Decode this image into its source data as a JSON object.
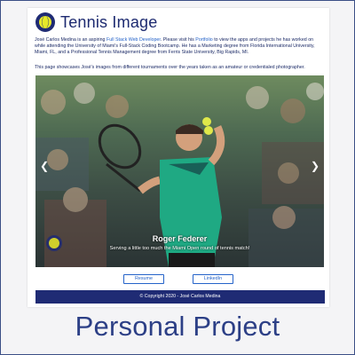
{
  "header": {
    "brand": "Tennis Image",
    "logo_icon": "tennis-ball-icon"
  },
  "bio": {
    "text1": "José Carlos Medina is an aspiring ",
    "link1": "Full Stack Web Developer",
    "text2": ". Please visit his ",
    "link2": "Portfolio",
    "text3": " to view the apps and projects he has worked on while attending the University of Miami's Full-Stack Coding Bootcamp. He has a Marketing degree from Florida International University, Miami, FL, and a Professional Tennis Management degree from Ferris State University, Big Rapids, MI."
  },
  "showcase": "This page showcases José's images from different tournaments over the years taken as an amateur or credentialed photographer.",
  "photo": {
    "caption_name": "Roger Federer",
    "caption_sub": "Serving a little too much the Miami Open round of tennis match!",
    "prev_icon": "chevron-left-icon",
    "next_icon": "chevron-right-icon"
  },
  "buttons": {
    "resume": "Resume",
    "linkedin": "LinkedIn"
  },
  "footer": "© Copyright 2020 - José Carlos Medina",
  "project_label": "Personal Project",
  "colors": {
    "navy": "#1f2b74",
    "link": "#2563c9",
    "ball": "#e6e82a",
    "shirt": "#1fa983"
  }
}
